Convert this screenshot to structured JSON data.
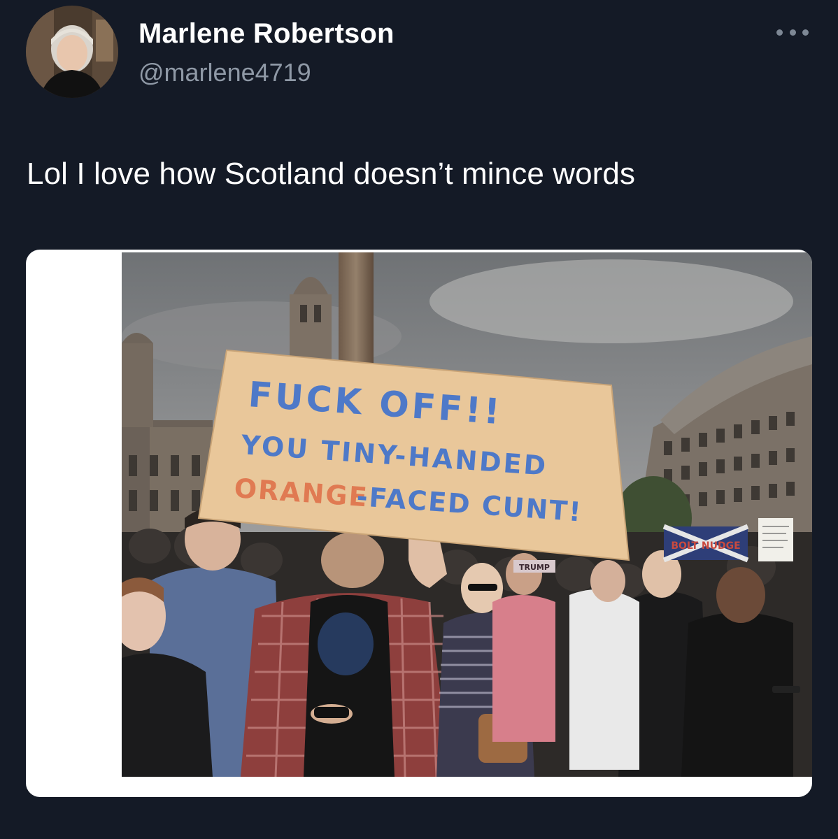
{
  "author": {
    "display_name": "Marlene Robertson",
    "handle": "@marlene4719",
    "avatar_icon": "avatar-photo"
  },
  "more_icon": "more-horizontal-icon",
  "tweet": {
    "text": "Lol I love how Scotland doesn’t mince words"
  },
  "media": {
    "sign": {
      "line1": "FUCK OFF!!",
      "line2": "YOU TINY-HANDED",
      "line3_orange": "ORANGE",
      "line3_blue": "-FACED CUNT!"
    },
    "small_sign": "TRUMP",
    "flag_sign": "BOLT NUDGE"
  },
  "colors": {
    "background": "#141a26",
    "name": "#ffffff",
    "handle": "#8f99a6",
    "card": "#ffffff",
    "sign_blue": "#4e79c8",
    "sign_orange": "#e07a52",
    "cardboard": "#e9c79a"
  }
}
